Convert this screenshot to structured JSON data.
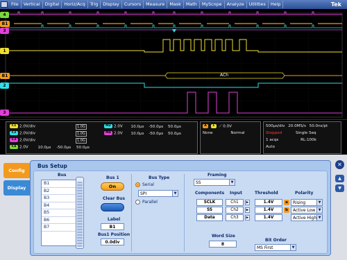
{
  "menubar": {
    "items": [
      "File",
      "Vertical",
      "Digital",
      "Horiz/Acq",
      "Trig",
      "Display",
      "Cursors",
      "Measure",
      "Mask",
      "Math",
      "MyScope",
      "Analyze",
      "Utilities",
      "Help"
    ],
    "brand": "Tek"
  },
  "screen": {
    "labels": {
      "c4": "4",
      "b1_top": "B1",
      "c1": "1",
      "b1_mid": "B1",
      "c2": "2",
      "c3": "3"
    },
    "bus_decode": "ACh"
  },
  "readouts": {
    "channels": [
      {
        "tag": "C1",
        "scale": "2.0V/div",
        "bw": "1.0G"
      },
      {
        "tag": "C2",
        "scale": "2.0V/div",
        "bw": "1.0G"
      },
      {
        "tag": "C3",
        "scale": "2.0V/div",
        "bw": "1.0G"
      }
    ],
    "ref4": {
      "tag": "C4",
      "scale": "2.0V",
      "t1": "10.0µs",
      "t2": "-50.0µs",
      "t3": "50.0µs"
    },
    "math": [
      {
        "tag": "M2",
        "scale": "2.0V",
        "t1": "10.0µs",
        "t2": "-50.0µs",
        "t3": "50.0µs"
      },
      {
        "tag": "M4",
        "scale": "2.0V",
        "t1": "10.0µs",
        "t2": "-50.0µs",
        "t3": "50.0µs"
      }
    ],
    "trigger": {
      "tag": "A",
      "source": "1",
      "level": "0.0V",
      "coupling": "None",
      "mode": "Normal"
    },
    "horizontal": {
      "scale": "500µs/div",
      "rate": "20.0MS/s",
      "res": "50.0ns/pt",
      "state": "Stopped",
      "seq": "Single Seq",
      "acqs": "1 acqs",
      "rl": "RL:100k",
      "auto": "Auto"
    }
  },
  "sidetabs": {
    "config": "Config",
    "display": "Display"
  },
  "panel": {
    "title": "Bus Setup",
    "bus_header": "Bus",
    "bus_list": [
      "B1",
      "B2",
      "B3",
      "B4",
      "B5",
      "B6",
      "B7"
    ],
    "bus1_label": "Bus 1",
    "on_label": "On",
    "clear_bus_label": "Clear Bus",
    "label_header": "Label",
    "label_value": "B1",
    "position_header": "Bus1 Position",
    "position_value": "0.0div",
    "bus_type_header": "Bus Type",
    "serial_label": "Serial",
    "parallel_label": "Parallel",
    "serial_type": "SPI",
    "framing_header": "Framing",
    "framing_value": "SS",
    "table_headers": {
      "components": "Components",
      "input": "Input",
      "threshold": "Threshold",
      "polarity": "Polarity"
    },
    "rows": [
      {
        "component": "SCLK",
        "input": "Ch1",
        "threshold": "1.4V",
        "marker": "a",
        "polarity": "Rising"
      },
      {
        "component": "SS",
        "input": "Ch2",
        "threshold": "1.4V",
        "marker": "b",
        "polarity": "Active Low"
      },
      {
        "component": "Data",
        "input": "Ch3",
        "threshold": "1.4V",
        "marker": "",
        "polarity": "Active High"
      }
    ],
    "word_size_header": "Word Size",
    "word_size_value": "8",
    "bit_order_header": "Bit Order",
    "bit_order_value": "MS First"
  },
  "colors": {
    "ch1": "#f0e030",
    "ch2": "#2ee0e8",
    "ch3": "#e040d8",
    "ch4": "#7cd83c",
    "bus": "#f39a1e"
  }
}
